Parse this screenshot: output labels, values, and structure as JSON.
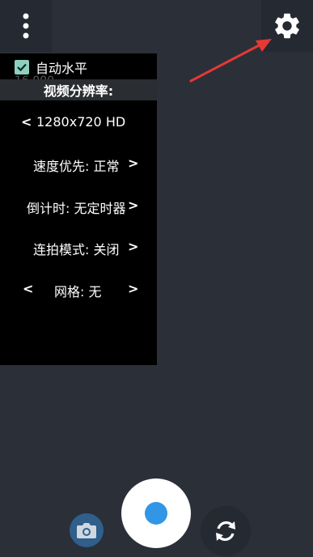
{
  "top_bar": {
    "menu_icon": "more-vert-icon",
    "settings_icon": "gear-icon"
  },
  "panel": {
    "auto_level_label": "自动水平",
    "auto_level_checked": true,
    "faint_text": "16.000",
    "resolution_title": "视频分辨率:",
    "resolution_value": "1280x720 HD",
    "speed_label": "速度优先: 正常",
    "timer_label": "倒计时: 无定时器",
    "burst_label": "连拍模式: 关闭",
    "grid_label": "网格: 无",
    "prev_arrow": "<",
    "next_arrow": ">"
  },
  "bottom_bar": {
    "photo_icon": "camera-icon",
    "shutter_icon": "record-icon",
    "switch_icon": "switch-camera-icon"
  },
  "colors": {
    "background": "#2b2f38",
    "panel": "#000000",
    "accent_blue": "#3296e6",
    "checkbox": "#8fcfc0",
    "annotation_red": "#e53935"
  }
}
